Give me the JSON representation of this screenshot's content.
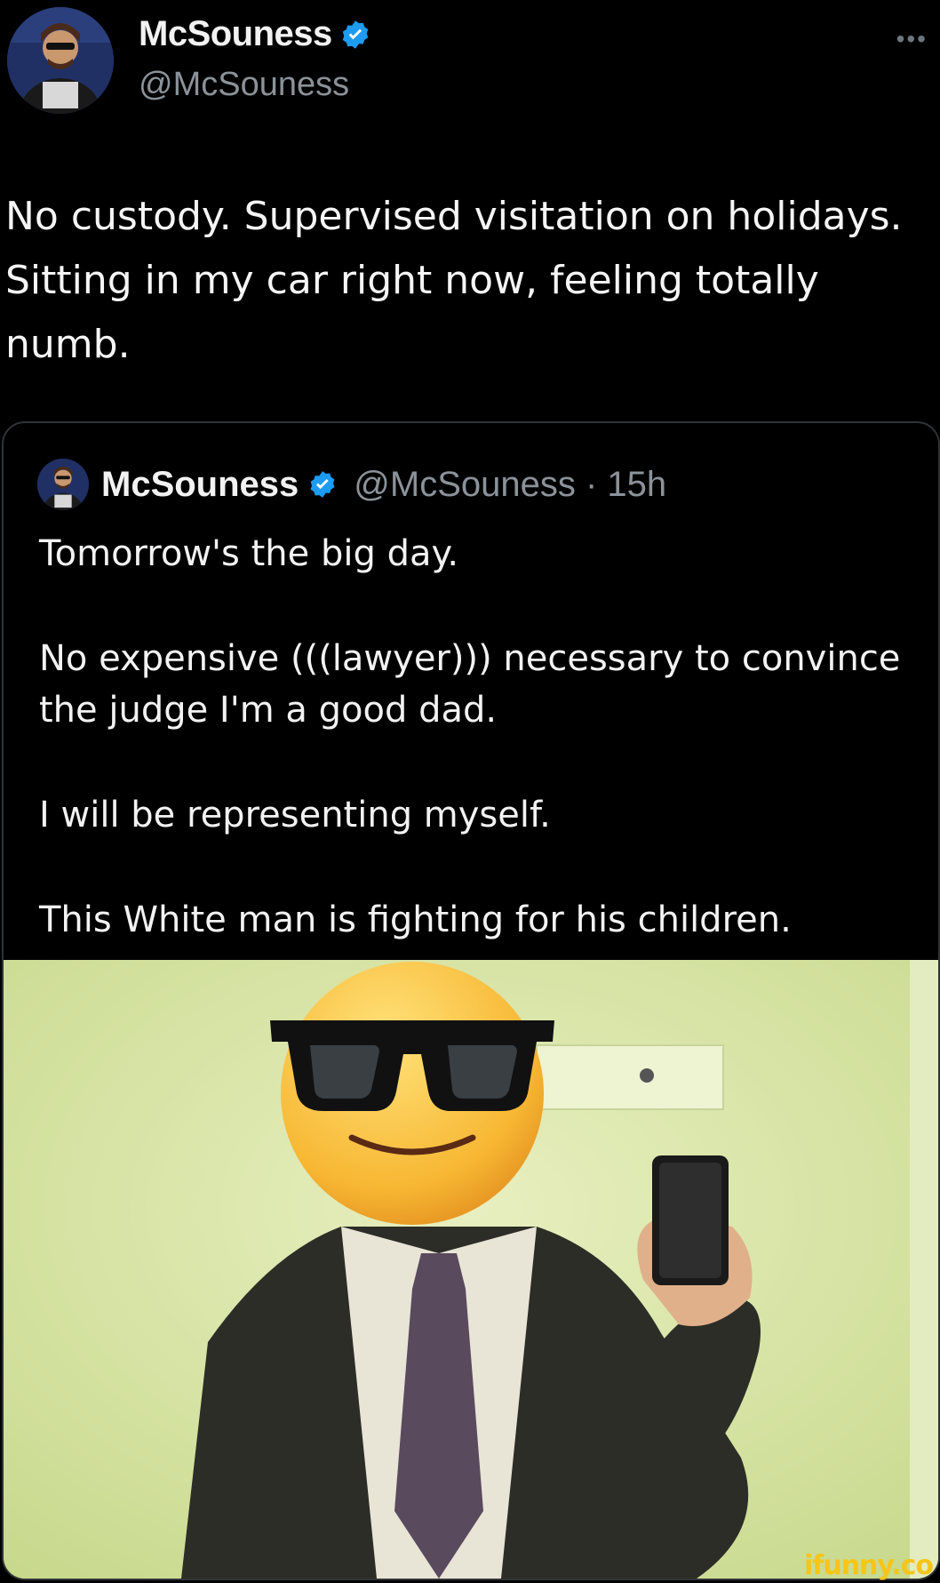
{
  "author": {
    "display_name": "McSouness",
    "handle": "@McSouness",
    "more_label": "•••"
  },
  "tweet": {
    "text": "No custody. Supervised visitation on holidays.\nSitting in my car right now, feeling totally\nnumb."
  },
  "quote": {
    "display_name": "McSouness",
    "handle_time": "@McSouness · 15h",
    "paragraphs": [
      "Tomorrow's the big day.",
      "No expensive (((lawyer))) necessary to convince the judge I'm a good dad.",
      "I will be representing myself.",
      "This White man is fighting for his children."
    ]
  },
  "watermark": "ifunny.co",
  "colors": {
    "background": "#000000",
    "verified_blue": "#1d9bf0",
    "secondary_text": "#8b9299",
    "border": "#2f3336"
  }
}
